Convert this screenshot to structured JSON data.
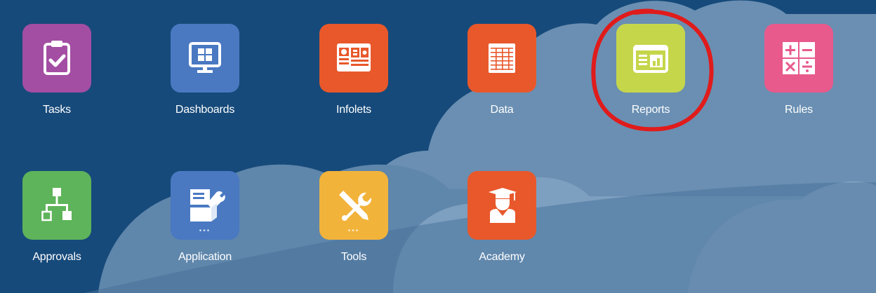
{
  "colors": {
    "background": "#164a7a",
    "cloud": "#6a8fb2",
    "annotation": "#e01b1b"
  },
  "tiles": [
    {
      "label": "Tasks",
      "icon": "clipboard-check-icon",
      "color": "#a34ea3"
    },
    {
      "label": "Dashboards",
      "icon": "monitor-dashboard-icon",
      "color": "#4a79c2"
    },
    {
      "label": "Infolets",
      "icon": "infolets-icon",
      "color": "#e8582b"
    },
    {
      "label": "Data",
      "icon": "table-grid-icon",
      "color": "#e8582b"
    },
    {
      "label": "Reports",
      "icon": "report-icon",
      "color": "#c6d64b"
    },
    {
      "label": "Rules",
      "icon": "calculator-icon",
      "color": "#e85a8c"
    },
    {
      "label": "Approvals",
      "icon": "hierarchy-icon",
      "color": "#5eb45a"
    },
    {
      "label": "Application",
      "icon": "application-icon",
      "color": "#4a79c2",
      "more": "•••"
    },
    {
      "label": "Tools",
      "icon": "tools-icon",
      "color": "#f2b33b",
      "more": "•••"
    },
    {
      "label": "Academy",
      "icon": "academy-icon",
      "color": "#e8582b"
    }
  ]
}
